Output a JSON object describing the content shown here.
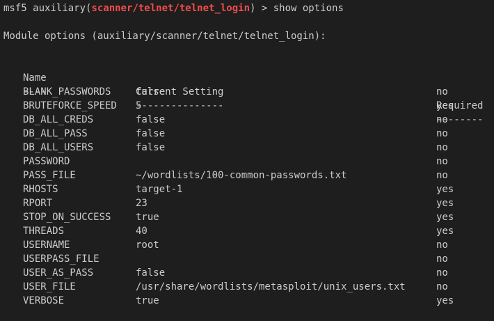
{
  "prompt": {
    "prefix": "msf5 auxiliary(",
    "module": "scanner/telnet/telnet_login",
    "suffix": ") > ",
    "command": "show options"
  },
  "module_options_heading": "Module options (auxiliary/scanner/telnet/telnet_login):",
  "table": {
    "headers": {
      "name": "Name",
      "setting": "Current Setting",
      "required": "Required"
    },
    "underlines": {
      "name": "----",
      "setting": "---------------",
      "required": "--------"
    },
    "rows": [
      {
        "name": "BLANK_PASSWORDS",
        "setting": "false",
        "required": "no"
      },
      {
        "name": "BRUTEFORCE_SPEED",
        "setting": "5",
        "required": "yes"
      },
      {
        "name": "DB_ALL_CREDS",
        "setting": "false",
        "required": "no"
      },
      {
        "name": "DB_ALL_PASS",
        "setting": "false",
        "required": "no"
      },
      {
        "name": "DB_ALL_USERS",
        "setting": "false",
        "required": "no"
      },
      {
        "name": "PASSWORD",
        "setting": "",
        "required": "no"
      },
      {
        "name": "PASS_FILE",
        "setting": "~/wordlists/100-common-passwords.txt",
        "required": "no"
      },
      {
        "name": "RHOSTS",
        "setting": "target-1",
        "required": "yes"
      },
      {
        "name": "RPORT",
        "setting": "23",
        "required": "yes"
      },
      {
        "name": "STOP_ON_SUCCESS",
        "setting": "true",
        "required": "yes"
      },
      {
        "name": "THREADS",
        "setting": "40",
        "required": "yes"
      },
      {
        "name": "USERNAME",
        "setting": "root",
        "required": "no"
      },
      {
        "name": "USERPASS_FILE",
        "setting": "",
        "required": "no"
      },
      {
        "name": "USER_AS_PASS",
        "setting": "false",
        "required": "no"
      },
      {
        "name": "USER_FILE",
        "setting": "/usr/share/wordlists/metasploit/unix_users.txt",
        "required": "no"
      },
      {
        "name": "VERBOSE",
        "setting": "true",
        "required": "yes"
      }
    ]
  },
  "colors": {
    "background": "#1e1e1e",
    "text": "#cccccc",
    "module_highlight": "#f14c4c"
  }
}
